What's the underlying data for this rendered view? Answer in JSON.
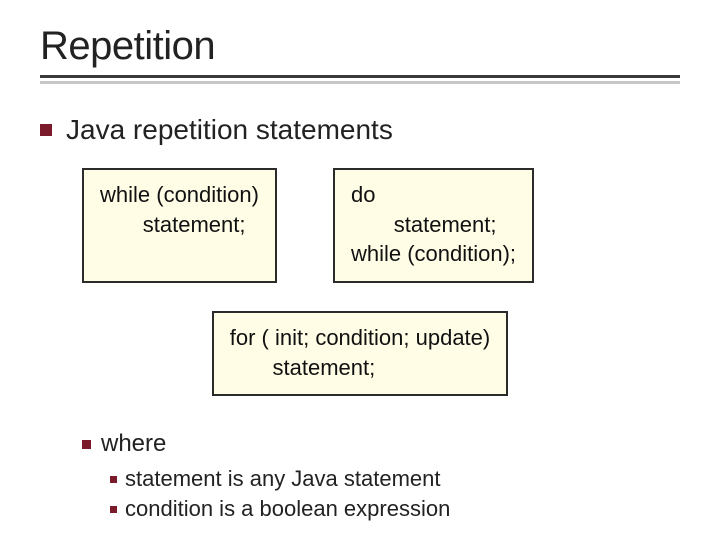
{
  "title": "Repetition",
  "bullet_main": "Java repetition statements",
  "code_while": "while (condition)\n       statement;",
  "code_do": "do\n       statement;\nwhile (condition);",
  "code_for": "for ( init; condition; update)\n       statement;",
  "sub": {
    "where": "where",
    "items": [
      "statement is any Java statement",
      "condition is a boolean expression"
    ]
  }
}
